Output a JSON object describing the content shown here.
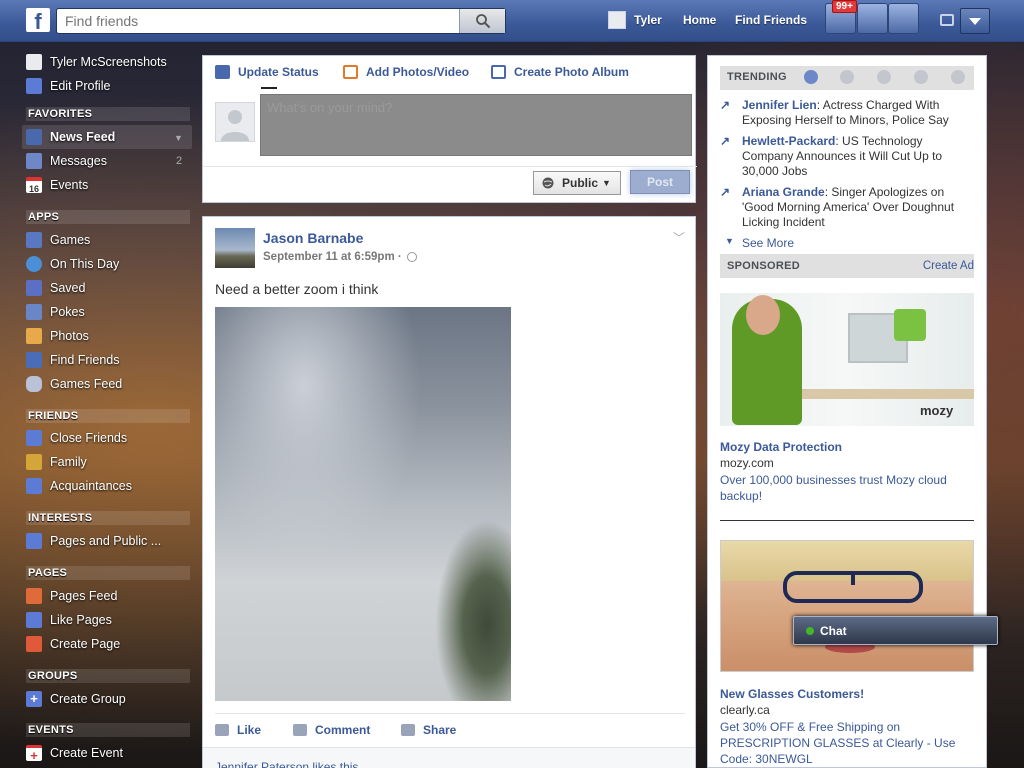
{
  "header": {
    "search_placeholder": "Find friends",
    "user_name": "Tyler",
    "home_label": "Home",
    "find_friends_label": "Find Friends",
    "notifications_count": "99+",
    "brand_color": "#3b5998"
  },
  "sidebar": {
    "profile_name": "Tyler McScreenshots",
    "edit_profile": "Edit Profile",
    "sections": [
      {
        "title": "FAVORITES",
        "items": [
          "News Feed",
          "Messages",
          "Events"
        ]
      },
      {
        "title": "APPS",
        "items": [
          "Games",
          "On This Day",
          "Saved",
          "Pokes",
          "Photos",
          "Find Friends",
          "Games Feed"
        ]
      },
      {
        "title": "FRIENDS",
        "items": [
          "Close Friends",
          "Family",
          "Acquaintances"
        ]
      },
      {
        "title": "INTERESTS",
        "items": [
          "Pages and Public ..."
        ]
      },
      {
        "title": "PAGES",
        "items": [
          "Pages Feed",
          "Like Pages",
          "Create Page"
        ]
      },
      {
        "title": "GROUPS",
        "items": [
          "Create Group"
        ]
      },
      {
        "title": "EVENTS",
        "items": [
          "Create Event"
        ]
      }
    ],
    "messages_count": "2",
    "events_icon_day": "16"
  },
  "composer": {
    "tab_status": "Update Status",
    "tab_photo": "Add Photos/Video",
    "tab_album": "Create Photo Album",
    "placeholder": "What's on your mind?",
    "privacy": "Public",
    "post_button": "Post"
  },
  "post": {
    "author": "Jason Barnabe",
    "time": "September 11 at 6:59pm ·",
    "text": "Need a better zoom i think",
    "like": "Like",
    "comment": "Comment",
    "share": "Share",
    "likes_summary": "Jennifer Paterson likes this."
  },
  "trending": {
    "title": "TRENDING",
    "items": [
      {
        "name": "Jennifer Lien",
        "text": ": Actress Charged With Exposing Herself to Minors, Police Say"
      },
      {
        "name": "Hewlett-Packard",
        "text": ": US Technology Company Announces it Will Cut Up to 30,000 Jobs"
      },
      {
        "name": "Ariana Grande",
        "text": ": Singer Apologizes on 'Good Morning America' Over Doughnut Licking Incident"
      }
    ],
    "see_more": "See More"
  },
  "sponsored": {
    "title": "SPONSORED",
    "create_ad": "Create Ad",
    "ads": [
      {
        "brand_mark": "mozy",
        "title": "Mozy Data Protection",
        "domain": "mozy.com",
        "body": "Over 100,000 businesses trust Mozy cloud backup!"
      },
      {
        "title": "New Glasses Customers!",
        "domain": "clearly.ca",
        "body": "Get 30% OFF & Free Shipping on PRESCRIPTION GLASSES at Clearly - Use Code: 30NEWGL"
      }
    ]
  },
  "chat": {
    "label": "Chat"
  }
}
